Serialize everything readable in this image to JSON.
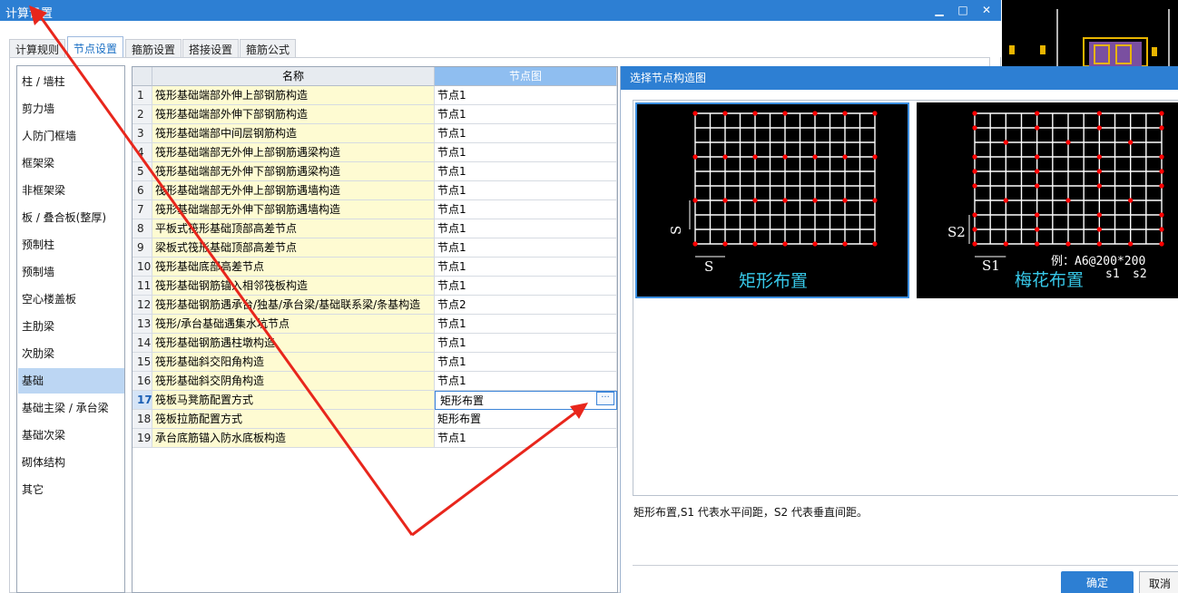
{
  "window": {
    "title": "计算设置",
    "minimize": "▁",
    "maximize": "□",
    "close": "✕"
  },
  "tabs": [
    "计算规则",
    "节点设置",
    "箍筋设置",
    "搭接设置",
    "箍筋公式"
  ],
  "active_tab": 1,
  "nav": {
    "items": [
      "柱 / 墙柱",
      "剪力墙",
      "人防门框墙",
      "框架梁",
      "非框架梁",
      "板 / 叠合板(整厚)",
      "预制柱",
      "预制墙",
      "空心楼盖板",
      "主肋梁",
      "次肋梁",
      "基础",
      "基础主梁 / 承台梁",
      "基础次梁",
      "砌体结构",
      "其它"
    ],
    "active": 11
  },
  "grid": {
    "headers": {
      "name": "名称",
      "node": "节点图"
    },
    "rows": [
      {
        "idx": "1",
        "name": "筏形基础端部外伸上部钢筋构造",
        "node": "节点1"
      },
      {
        "idx": "2",
        "name": "筏形基础端部外伸下部钢筋构造",
        "node": "节点1"
      },
      {
        "idx": "3",
        "name": "筏形基础端部中间层钢筋构造",
        "node": "节点1"
      },
      {
        "idx": "4",
        "name": "筏形基础端部无外伸上部钢筋遇梁构造",
        "node": "节点1"
      },
      {
        "idx": "5",
        "name": "筏形基础端部无外伸下部钢筋遇梁构造",
        "node": "节点1"
      },
      {
        "idx": "6",
        "name": "筏形基础端部无外伸上部钢筋遇墙构造",
        "node": "节点1"
      },
      {
        "idx": "7",
        "name": "筏形基础端部无外伸下部钢筋遇墙构造",
        "node": "节点1"
      },
      {
        "idx": "8",
        "name": "平板式筏形基础顶部高差节点",
        "node": "节点1"
      },
      {
        "idx": "9",
        "name": "梁板式筏形基础顶部高差节点",
        "node": "节点1"
      },
      {
        "idx": "10",
        "name": "筏形基础底部高差节点",
        "node": "节点1"
      },
      {
        "idx": "11",
        "name": "筏形基础钢筋锚入相邻筏板构造",
        "node": "节点1"
      },
      {
        "idx": "12",
        "name": "筏形基础钢筋遇承台/独基/承台梁/基础联系梁/条基构造",
        "node": "节点2"
      },
      {
        "idx": "13",
        "name": "筏形/承台基础遇集水坑节点",
        "node": "节点1"
      },
      {
        "idx": "14",
        "name": "筏形基础钢筋遇柱墩构造",
        "node": "节点1"
      },
      {
        "idx": "15",
        "name": "筏形基础斜交阳角构造",
        "node": "节点1"
      },
      {
        "idx": "16",
        "name": "筏形基础斜交阴角构造",
        "node": "节点1"
      },
      {
        "idx": "17",
        "name": "筏板马凳筋配置方式",
        "node": "矩形布置"
      },
      {
        "idx": "18",
        "name": "筏板拉筋配置方式",
        "node": "矩形布置"
      },
      {
        "idx": "19",
        "name": "承台底筋锚入防水底板构造",
        "node": "节点1"
      }
    ],
    "selected_row": 16,
    "ellipsis": "···"
  },
  "node_dialog": {
    "title": "选择节点构造图",
    "diagram1": {
      "label": "矩形布置",
      "s_v": "S",
      "s_h": "S"
    },
    "diagram2": {
      "label": "梅花布置",
      "s_v": "S2",
      "s_h": "S1",
      "example": "例：A6@200*200",
      "s1": "s1",
      "s2": "s2"
    },
    "caption": "矩形布置,S1 代表水平间距，S2 代表垂直间距。",
    "ok": "确定",
    "cancel": "取消"
  },
  "colors": {
    "accent": "#2d7fd3",
    "name_cell_bg": "#fefbd2",
    "selected_nav": "#bcd6f3",
    "arrow": "#e8261c",
    "grid_line": "#ffffff",
    "dot": "#ff0000"
  }
}
